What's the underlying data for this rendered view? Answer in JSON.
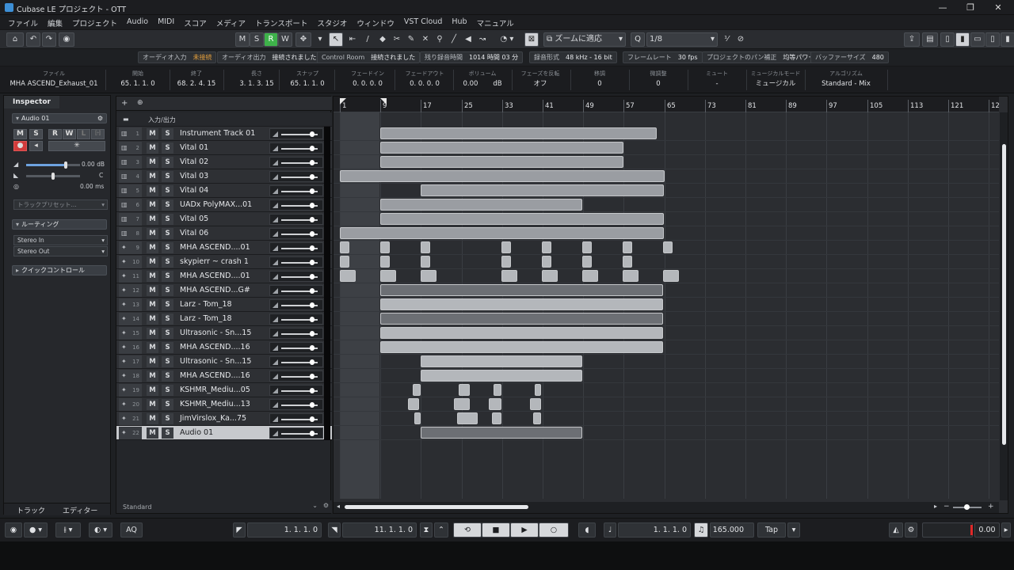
{
  "title_bar": {
    "title": "Cubase LE プロジェクト - OTT",
    "minimize": "—",
    "maximize": "❐",
    "close": "✕"
  },
  "menu": [
    "ファイル",
    "編集",
    "プロジェクト",
    "Audio",
    "MIDI",
    "スコア",
    "メディア",
    "トランスポート",
    "スタジオ",
    "ウィンドウ",
    "VST Cloud",
    "Hub",
    "マニュアル"
  ],
  "toolbar": {
    "m_label": "M",
    "s_label": "S",
    "r_label": "R",
    "w_label": "W",
    "zoom_mode": "ズームに適応",
    "quantize_value": "1/8",
    "colors": {
      "r_active": "#3eb24a"
    }
  },
  "status_line": [
    {
      "label": "オーディオ入力",
      "value": "未接続"
    },
    {
      "label": "オーディオ出力",
      "value": "接続されました"
    },
    {
      "label": "Control Room",
      "value": "接続されました"
    },
    {
      "label": "残り録音時間",
      "value": "1014 時間 03 分"
    },
    {
      "label": "録音形式",
      "value": "48 kHz - 16 bit"
    },
    {
      "label": "フレームレート",
      "value": "30 fps"
    },
    {
      "label": "プロジェクトのパン補正",
      "value": "均等パワー"
    },
    {
      "label": "バッファーサイズ",
      "value": "480"
    }
  ],
  "info_line": {
    "file": {
      "label": "ファイル",
      "value": "MHA ASCEND_Exhaust_01"
    },
    "start": {
      "label": "開始",
      "value": "65. 1. 1.   0"
    },
    "end": {
      "label": "終了",
      "value": "68. 2. 4. 15"
    },
    "length": {
      "label": "長さ",
      "value": "3. 1. 3. 15"
    },
    "snap": {
      "label": "スナップ",
      "value": "65. 1. 1.   0"
    },
    "fade_in": {
      "label": "フェードイン",
      "value": "0. 0. 0.   0"
    },
    "fade_out": {
      "label": "フェードアウト",
      "value": "0. 0. 0.   0"
    },
    "volume": {
      "label": "ボリューム",
      "value": "0.00",
      "unit": "dB"
    },
    "invert_phase": {
      "label": "フェーズを反転",
      "value": "オフ"
    },
    "transpose": {
      "label": "移調",
      "value": "0"
    },
    "fine_tune": {
      "label": "微調整",
      "value": "0"
    },
    "mute": {
      "label": "ミュート",
      "value": "-"
    },
    "musical_mode": {
      "label": "ミュージカルモード",
      "value": "ミュージカル"
    },
    "algorithm": {
      "label": "アルゴリズム",
      "value": "Standard - Mix"
    }
  },
  "inspector": {
    "tab_label": "Inspector",
    "track_name": "Audio 01",
    "volume_value": "0.00 dB",
    "pan_value": "C",
    "delay_value": "0.00 ms",
    "preset_placeholder": "トラックプリセット...",
    "routing_label": "ルーティング",
    "input_routing": "Stereo In",
    "output_routing": "Stereo Out",
    "quick_controls_label": "クイックコントロール",
    "bottom_tabs": [
      "トラック",
      "エディター"
    ]
  },
  "track_list": {
    "header_label": "入力/出力",
    "footer_label": "Standard",
    "tracks": [
      {
        "num": "1",
        "type": "inst",
        "name": "Instrument Track 01"
      },
      {
        "num": "2",
        "type": "inst",
        "name": "Vital 01"
      },
      {
        "num": "3",
        "type": "inst",
        "name": "Vital 02"
      },
      {
        "num": "4",
        "type": "inst",
        "name": "Vital 03"
      },
      {
        "num": "5",
        "type": "inst",
        "name": "Vital 04"
      },
      {
        "num": "6",
        "type": "inst",
        "name": "UADx PolyMAX...01"
      },
      {
        "num": "7",
        "type": "inst",
        "name": "Vital 05"
      },
      {
        "num": "8",
        "type": "inst",
        "name": "Vital 06"
      },
      {
        "num": "9",
        "type": "audio",
        "name": "MHA ASCEND....01"
      },
      {
        "num": "10",
        "type": "audio",
        "name": "skypierr ~ crash 1"
      },
      {
        "num": "11",
        "type": "audio",
        "name": "MHA ASCEND....01"
      },
      {
        "num": "12",
        "type": "audio",
        "name": "MHA ASCEND...G#"
      },
      {
        "num": "13",
        "type": "audio",
        "name": "Larz - Tom_18"
      },
      {
        "num": "14",
        "type": "audio",
        "name": "Larz - Tom_18"
      },
      {
        "num": "15",
        "type": "audio",
        "name": "Ultrasonic -  Sn...15"
      },
      {
        "num": "16",
        "type": "audio",
        "name": "MHA ASCEND....16"
      },
      {
        "num": "17",
        "type": "audio",
        "name": "Ultrasonic -  Sn...15"
      },
      {
        "num": "18",
        "type": "audio",
        "name": "MHA ASCEND....16"
      },
      {
        "num": "19",
        "type": "audio",
        "name": "KSHMR_Mediu...05"
      },
      {
        "num": "20",
        "type": "audio",
        "name": "KSHMR_Mediu...13"
      },
      {
        "num": "21",
        "type": "audio",
        "name": "JimVirslox_Ka...75"
      },
      {
        "num": "22",
        "type": "audio",
        "name": "Audio 01"
      }
    ]
  },
  "ruler_bars": [
    "1",
    "9",
    "17",
    "25",
    "33",
    "41",
    "49",
    "57",
    "65",
    "73",
    "81",
    "89",
    "97",
    "105",
    "113",
    "121",
    "12"
  ],
  "transport": {
    "aq_label": "AQ",
    "left_locator": "1.  1.  1.    0",
    "right_locator": "11.  1.  1.    0",
    "position": "1.  1.  1.    0",
    "tempo": "165.000",
    "tap_label": "Tap",
    "level": "0.00"
  }
}
